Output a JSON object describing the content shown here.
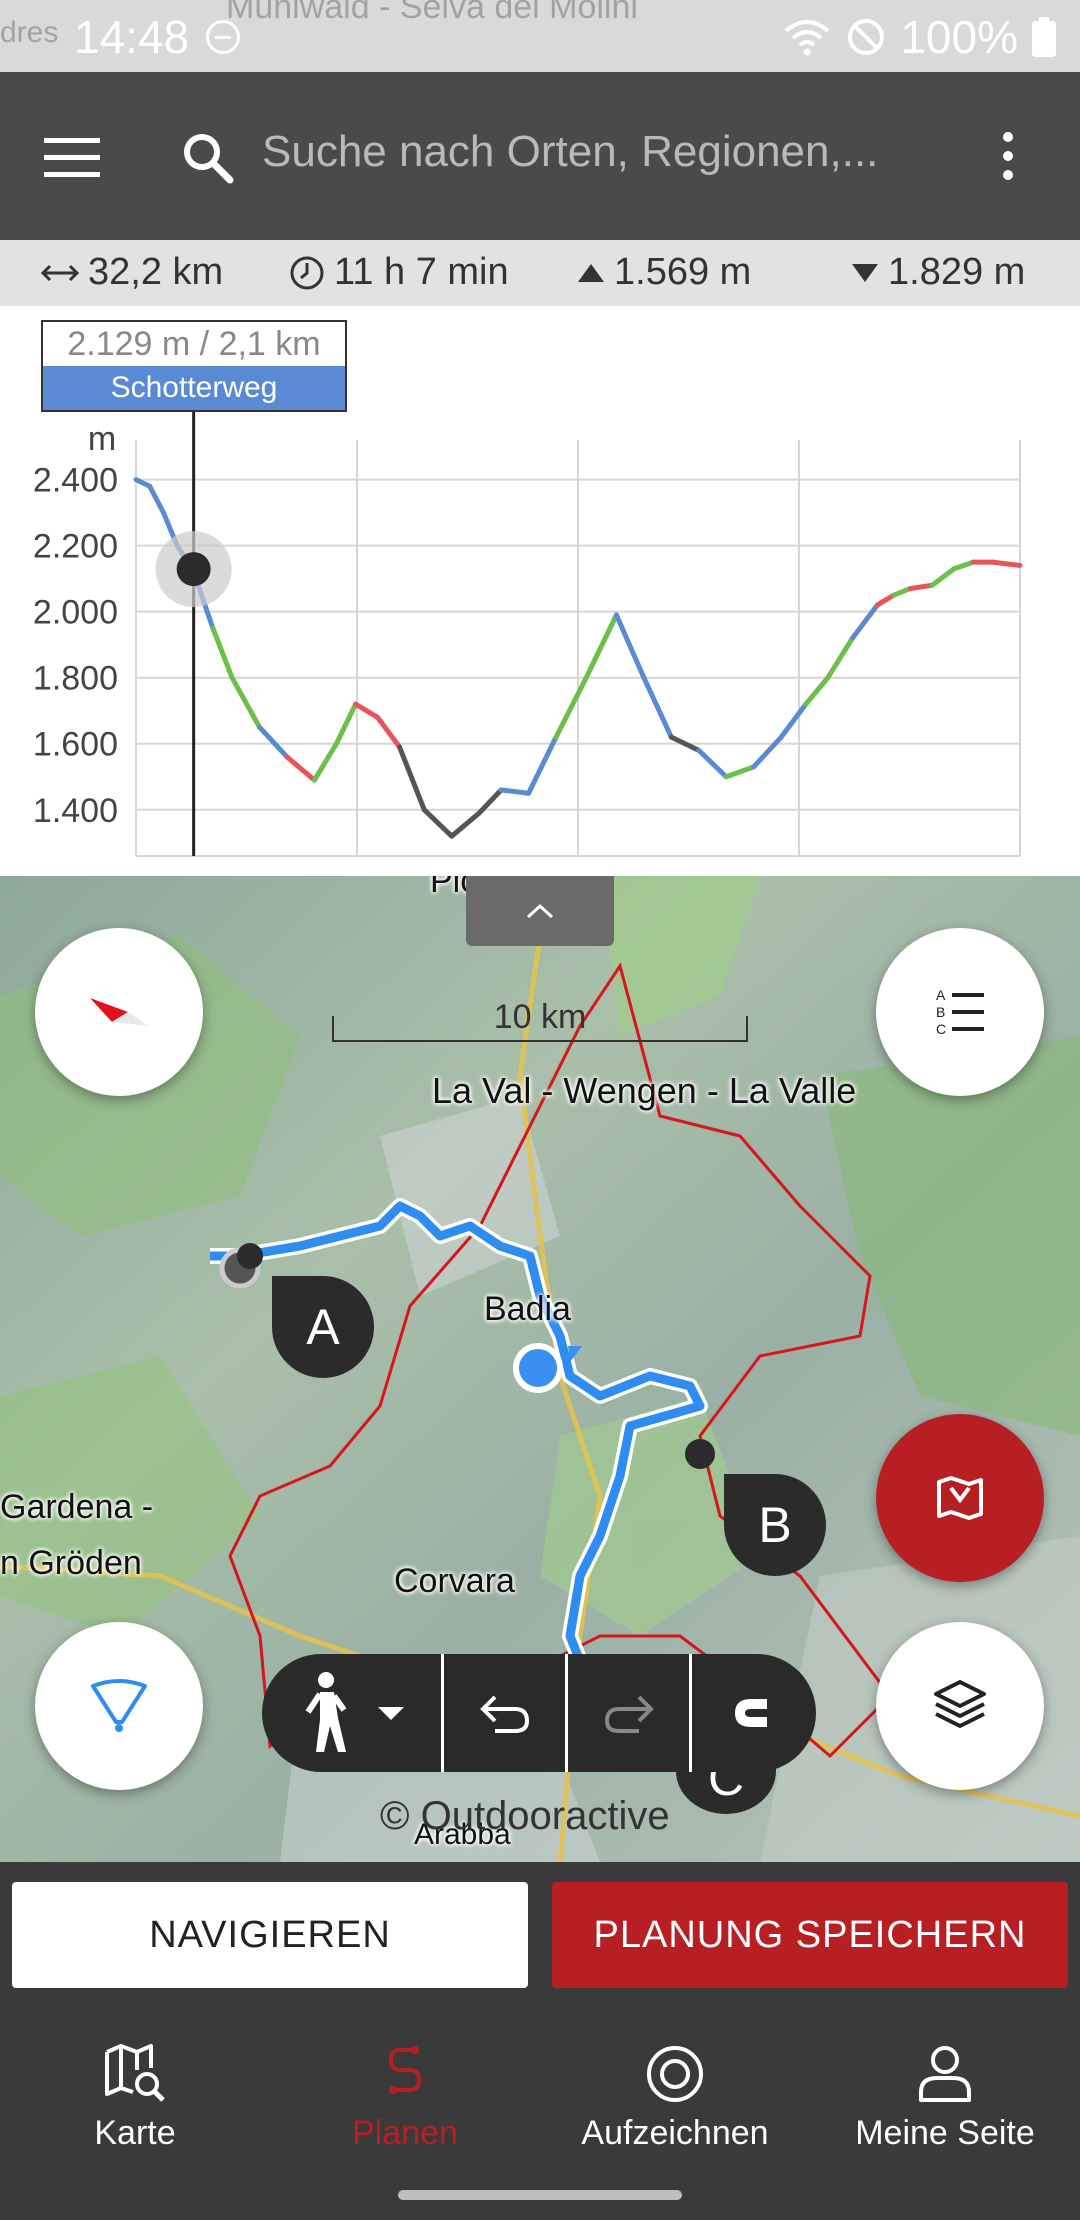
{
  "status_bar": {
    "time": "14:48",
    "battery": "100%",
    "background_map_text": "Muhlwald - Selva dei Molini",
    "background_map_text_left": "dres"
  },
  "app_bar": {
    "search_placeholder": "Suche nach Orten, Regionen,..."
  },
  "stats": {
    "distance": "32,2 km",
    "duration": "11 h 7 min",
    "ascent": "1.569 m",
    "descent": "1.829 m"
  },
  "chart_data": {
    "type": "line",
    "ylabel": "m",
    "yticks": [
      "2.400",
      "2.200",
      "2.000",
      "1.800",
      "1.600",
      "1.400"
    ],
    "ylim": [
      1260,
      2520
    ],
    "xlim": [
      0,
      32.2
    ],
    "grid": true,
    "series": [
      {
        "x": [
          0,
          0.5,
          1,
          1.5,
          2.1,
          2.8,
          3.5,
          4.5,
          5.5,
          6.5,
          7.3,
          8,
          8.8,
          9.6,
          10.5,
          11.5,
          12.5,
          13.3,
          14.3,
          15.3,
          16.4,
          17.5,
          18.5,
          19.5,
          20.5,
          21.5,
          22.5,
          23.5,
          24.4,
          25.2,
          26.1,
          27,
          27.6,
          28.2,
          29,
          29.8,
          30.5,
          31.2,
          32.2
        ],
        "values": [
          2400,
          2380,
          2300,
          2200,
          2120,
          1950,
          1800,
          1650,
          1560,
          1490,
          1600,
          1720,
          1680,
          1590,
          1400,
          1320,
          1390,
          1460,
          1450,
          1620,
          1800,
          1990,
          1800,
          1620,
          1580,
          1500,
          1530,
          1620,
          1720,
          1800,
          1920,
          2020,
          2050,
          2070,
          2080,
          2130,
          2150,
          2150,
          2140
        ],
        "segments": [
          "blue",
          "blue",
          "blue",
          "blue",
          "blue",
          "green",
          "green",
          "blue",
          "red",
          "green",
          "green",
          "red",
          "red",
          "gray",
          "gray",
          "gray",
          "gray",
          "blue",
          "blue",
          "green",
          "green",
          "blue",
          "blue",
          "gray",
          "blue",
          "green",
          "blue",
          "blue",
          "green",
          "green",
          "blue",
          "red",
          "green",
          "red",
          "green",
          "green",
          "red",
          "red"
        ]
      }
    ],
    "cursor": {
      "x": 2.1,
      "value": 2129
    }
  },
  "tooltip": {
    "value": "2.129 m / 2,1 km",
    "surface": "Schotterweg"
  },
  "colors": {
    "accent": "#b81f24",
    "route": "#2f8cf0",
    "surface_blue": "#5b8ad4",
    "surface_green": "#6cbf4a",
    "surface_red": "#e8545a",
    "surface_gray": "#555555",
    "boundary": "#d8141c"
  },
  "map": {
    "scale": "10 km",
    "copyright": "© Outdooractive",
    "labels": {
      "la_val": "La Val - Wengen - La Valle",
      "badia": "Badia",
      "gardena_1": "Gardena -",
      "gardena_2": "n Gröden",
      "corvara": "Corvara",
      "arabba": "Arabba",
      "top": "Piccolino"
    },
    "waypoints": [
      "A",
      "B",
      "C"
    ]
  },
  "buttons": {
    "navigate": "NAVIGIEREN",
    "save": "PLANUNG SPEICHERN"
  },
  "bottom_nav": {
    "items": [
      {
        "label": "Karte",
        "icon": "map-search-icon"
      },
      {
        "label": "Planen",
        "icon": "route-plan-icon"
      },
      {
        "label": "Aufzeichnen",
        "icon": "record-icon"
      },
      {
        "label": "Meine Seite",
        "icon": "person-icon"
      }
    ]
  }
}
